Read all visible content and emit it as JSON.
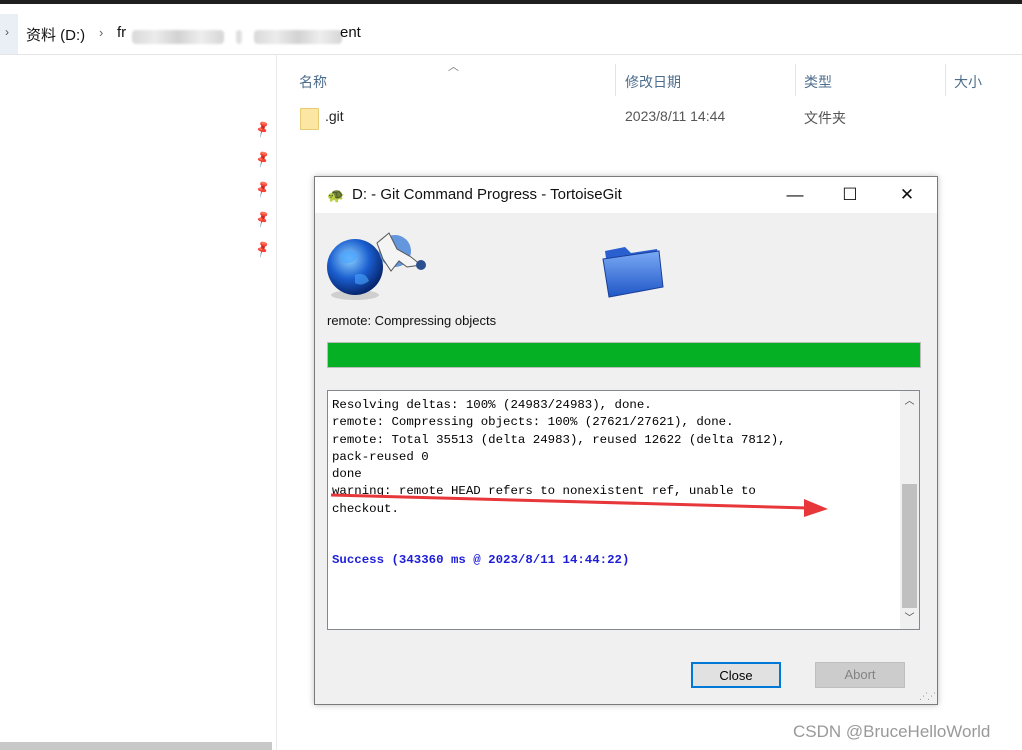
{
  "explorer": {
    "breadcrumb": {
      "drive": "资料 (D:)",
      "folder_visible_prefix": "fr",
      "folder_visible_suffix": "ent"
    },
    "columns": [
      "名称",
      "修改日期",
      "类型",
      "大小"
    ],
    "rows": [
      {
        "name": ".git",
        "date": "2023/8/11 14:44",
        "type": "文件夹",
        "size": ""
      }
    ]
  },
  "dialog": {
    "title": "D: - Git Command Progress - TortoiseGit",
    "status_text": "remote: Compressing objects",
    "progress_percent": 100,
    "log_lines": [
      "Resolving deltas: 100% (24983/24983), done.",
      "remote: Compressing objects: 100% (27621/27621), done.",
      "remote: Total 35513 (delta 24983), reused 12622 (delta 7812),",
      "pack-reused 0",
      "done",
      "warning: remote HEAD refers to nonexistent ref, unable to",
      "checkout."
    ],
    "success_line": "Success (343360 ms @ 2023/8/11 14:44:22)",
    "buttons": {
      "close": "Close",
      "abort": "Abort"
    }
  },
  "watermark": "CSDN @BruceHelloWorld",
  "colors": {
    "progress": "#06b025",
    "success": "#1d1dd8",
    "annotation_arrow": "#e8373a"
  }
}
